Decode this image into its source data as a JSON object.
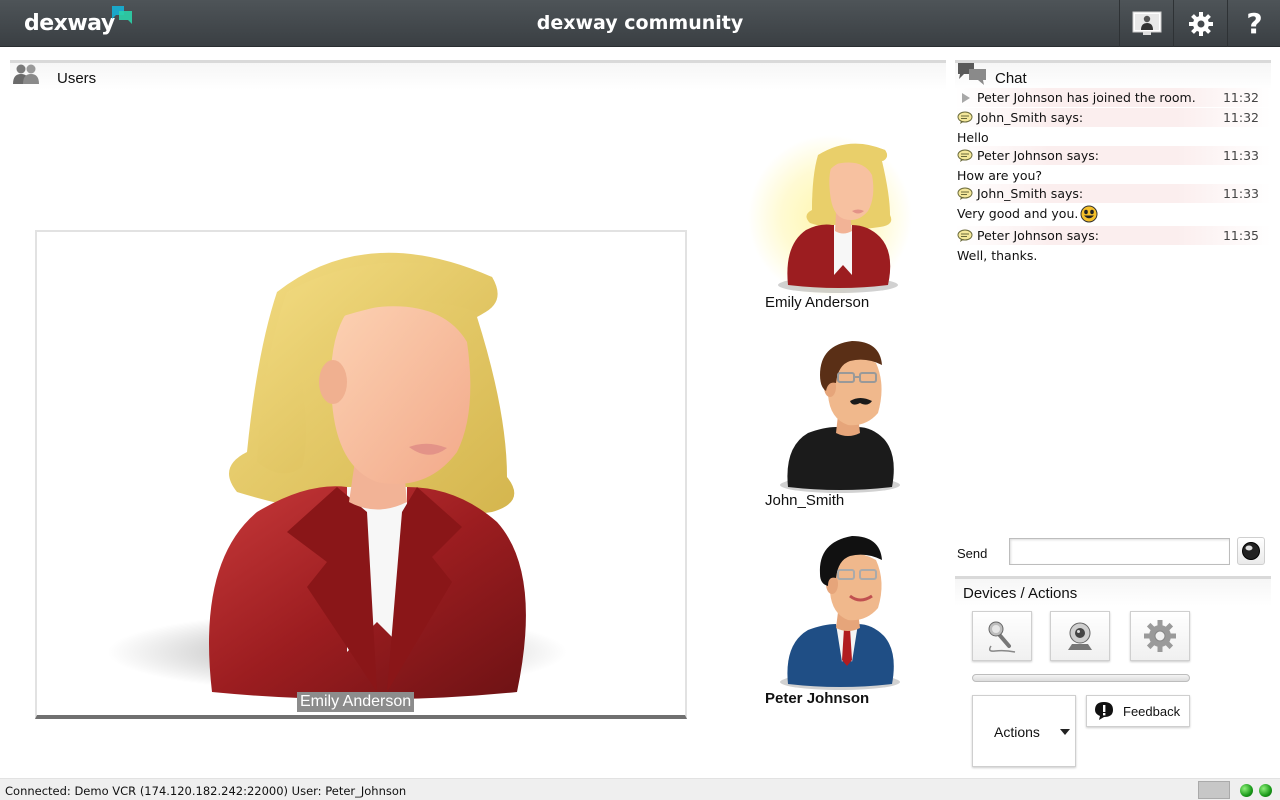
{
  "header": {
    "logo_text": "dexway",
    "title": "dexway community",
    "help_label": "?",
    "icons": [
      "monitor-user-icon",
      "gear-icon",
      "help-icon"
    ]
  },
  "users_panel": {
    "title": "Users",
    "main_video": {
      "name": "Emily Anderson"
    },
    "users": [
      {
        "name": "Emily Anderson",
        "speaking": true
      },
      {
        "name": "John_Smith",
        "speaking": false
      },
      {
        "name": "Peter Johnson",
        "speaking": false,
        "current_user": true
      }
    ]
  },
  "chat_panel": {
    "title": "Chat",
    "messages": [
      {
        "type": "event",
        "text": "Peter Johnson has joined the room.",
        "time": "11:32"
      },
      {
        "type": "says",
        "text": "John_Smith says:",
        "time": "11:32"
      },
      {
        "type": "body",
        "text": "Hello"
      },
      {
        "type": "says",
        "text": "Peter Johnson says:",
        "time": "11:33"
      },
      {
        "type": "body",
        "text": "How are you?"
      },
      {
        "type": "says",
        "text": "John_Smith says:",
        "time": "11:33"
      },
      {
        "type": "body",
        "text": "Very good and you.",
        "emoji": "smiley-icon"
      },
      {
        "type": "says",
        "text": "Peter Johnson says:",
        "time": "11:35"
      },
      {
        "type": "body",
        "text": "Well, thanks."
      }
    ],
    "send_label": "Send",
    "send_value": ""
  },
  "devices_panel": {
    "title": "Devices / Actions",
    "buttons": [
      "microphone-icon",
      "webcam-icon",
      "gear-icon"
    ],
    "actions_label": "Actions",
    "feedback_label": "Feedback"
  },
  "status_bar": {
    "text": "Connected: Demo VCR (174.120.182.242:22000) User: Peter_Johnson"
  },
  "colors": {
    "topbar": "#3f4448",
    "jacket_red": "#9c1d20",
    "hair_blonde": "#e9cf6a",
    "status_green": "#1a9a1a"
  }
}
